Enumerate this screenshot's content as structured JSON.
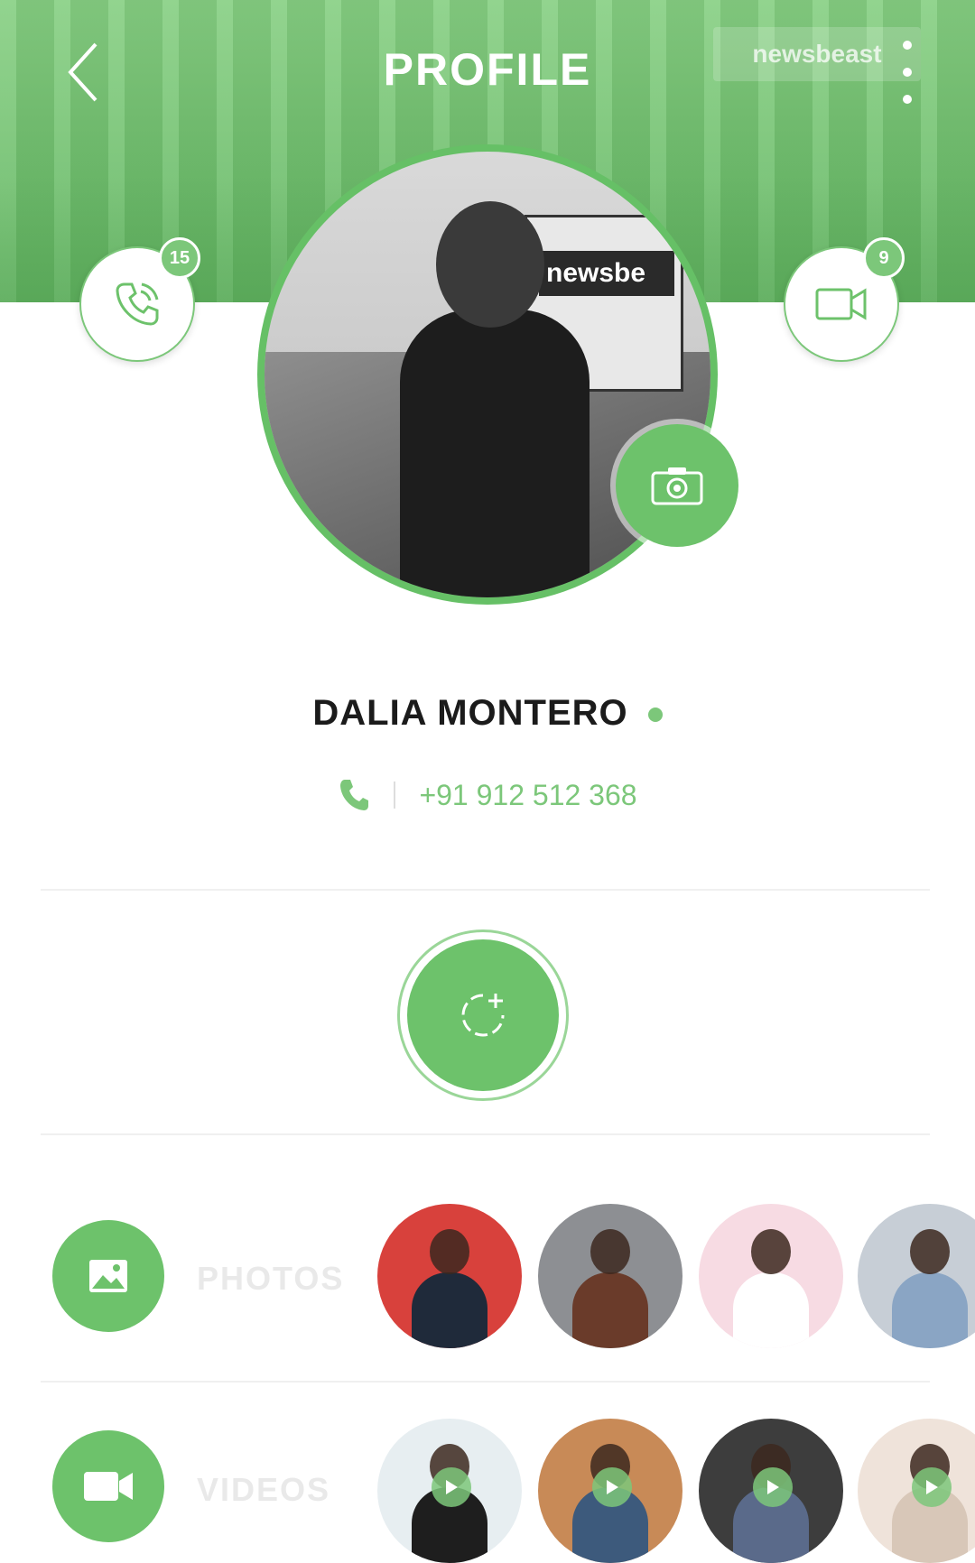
{
  "header": {
    "title": "PROFILE",
    "banner_text": "newsbeast",
    "back_icon": "chevron-left-icon",
    "more_icon": "more-vertical-icon"
  },
  "profile": {
    "name": "DALIA MONTERO",
    "phone": "+91 912 512 368",
    "online": true,
    "photo_sign_text": "newsbe"
  },
  "calls": {
    "count": "15",
    "icon": "phone-call-icon"
  },
  "videos_calls": {
    "count": "9",
    "icon": "video-camera-icon"
  },
  "camera_icon": "camera-icon",
  "add_story_icon": "add-story-icon",
  "photos": {
    "label": "PHOTOS",
    "icon": "image-icon",
    "thumbnails": [
      {
        "bg": "#d8413c",
        "body": "#1f2a3a"
      },
      {
        "bg": "#8d8f93",
        "body": "#6a3b2a"
      },
      {
        "bg": "#f7dbe3",
        "body": "#ffffff"
      },
      {
        "bg": "#c7ced6",
        "body": "#8aa5c4"
      }
    ]
  },
  "videos": {
    "label": "VIDEOS",
    "icon": "video-icon",
    "thumbnails": [
      {
        "bg": "#e7eef1",
        "body": "#1e1e1e"
      },
      {
        "bg": "#c88a57",
        "body": "#3d5a7c"
      },
      {
        "bg": "#3d3d3d",
        "body": "#5a6a8a"
      },
      {
        "bg": "#efe3da",
        "body": "#d8c7b8"
      }
    ]
  },
  "colors": {
    "accent": "#6dc26b",
    "accent_light": "#7cc77a",
    "text_dark": "#1b1b1b"
  }
}
